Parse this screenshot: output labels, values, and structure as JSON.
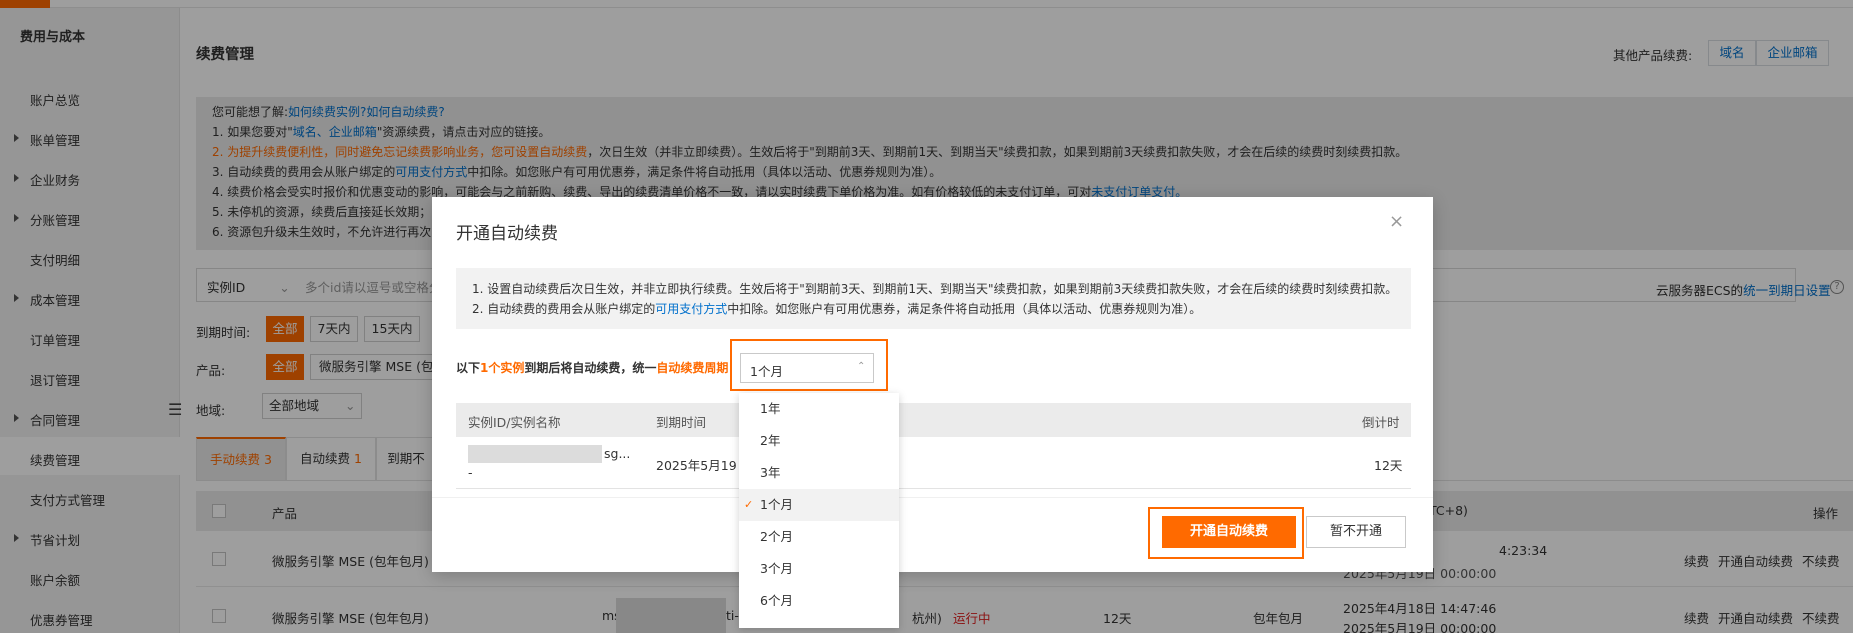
{
  "sidebar": {
    "title": "费用与成本",
    "items": [
      {
        "label": "账户总览",
        "arrow": false
      },
      {
        "label": "账单管理",
        "arrow": true
      },
      {
        "label": "企业财务",
        "arrow": true
      },
      {
        "label": "分账管理",
        "arrow": true
      },
      {
        "label": "支付明细",
        "arrow": false
      },
      {
        "label": "成本管理",
        "arrow": true
      },
      {
        "label": "订单管理",
        "arrow": false
      },
      {
        "label": "退订管理",
        "arrow": false
      },
      {
        "label": "合同管理",
        "arrow": true
      },
      {
        "label": "续费管理",
        "arrow": false,
        "active": true
      },
      {
        "label": "支付方式管理",
        "arrow": false
      },
      {
        "label": "节省计划",
        "arrow": true
      },
      {
        "label": "账户余额",
        "arrow": false
      },
      {
        "label": "优惠券管理",
        "arrow": false
      }
    ],
    "collapse_icon": "☰"
  },
  "header": {
    "title": "续费管理",
    "other_label": "其他产品续费:",
    "other_links": [
      "域名",
      "企业邮箱"
    ]
  },
  "notice": {
    "l0_a": "您可能想了解:",
    "l0_b": "如何续费实例?",
    "l0_c": "如何自动续费?",
    "l1_a": "1. 如果您要对\"",
    "l1_b": "域名、企业邮箱",
    "l1_c": "\"资源续费，请点击对应的链接。",
    "l2_a": "2. 为提升续费便利性，同时避免忘记续费影响业务，您可设置自动续费",
    "l2_b": "，次日生效（并非立即续费）。生效后将于\"到期前3天、到期前1天、到期当天\"续费扣款，如果到期前3天续费扣款失败，才会在后续的续费时刻续费扣款。",
    "l3_a": "3. 自动续费的费用会从账户绑定的",
    "l3_b": "可用支付方式",
    "l3_c": "中扣除。如您账户有可用优惠券，满足条件将自动抵用（具体以活动、优惠券规则为准）。",
    "l4_a": "4. 续费价格会受实时报价和优惠变动的影响，可能会与之前新购、续费、导出的续费清单价格不一致，请以实时续费下单价格为准。如有价格较低的未支付订单，可对",
    "l4_b": "未支付订单支付。",
    "l5": "5. 未停机的资源，续费后直接延长效期；",
    "l6": "6. 资源包升级未生效时，不允许进行再次"
  },
  "filters": {
    "instance_select": "实例ID",
    "search_placeholder": "多个id请以逗号或空格分",
    "ecs_text": "云服务器ECS的",
    "ecs_link": "统一到期日设置",
    "help_icon": "?",
    "expiry_label": "到期时间:",
    "expiry_chips": [
      "全部",
      "7天内",
      "15天内"
    ],
    "product_label": "产品:",
    "product_chips": [
      "全部",
      "微服务引擎 MSE (包年"
    ],
    "region_label": "地域:",
    "region_value": "全部地域",
    "chevron": "⌄"
  },
  "tabs": [
    {
      "label": "手动续费",
      "count": "3"
    },
    {
      "label": "自动续费",
      "count": "1"
    },
    {
      "label": "到期不",
      "count": ""
    }
  ],
  "table": {
    "col_product": "产品",
    "col_time": "TC+8)",
    "col_action": "操作",
    "rows": [
      {
        "product": "微服务引擎 MSE (包年包月)",
        "time1": "4:23:34",
        "time2": "2025年5月19日 00:00:00",
        "actions": [
          "续费",
          "开通自动续费",
          "不续费"
        ]
      },
      {
        "product": "微服务引擎 MSE (包年包月)",
        "id_prefix": "ms",
        "id_frag": "ti-",
        "region": "杭州)",
        "status": "运行中",
        "countdown": "12天",
        "billing": "包年包月",
        "time1": "2025年4月18日 14:47:46",
        "time2": "2025年5月19日 00:00:00",
        "actions": [
          "续费",
          "开通自动续费",
          "不续费"
        ]
      }
    ]
  },
  "modal": {
    "title": "开通自动续费",
    "close_icon": "×",
    "note1": "1. 设置自动续费后次日生效，并非立即执行续费。生效后将于\"到期前3天、到期前1天、到期当天\"续费扣款，如果到期前3天续费扣款失败，才会在后续的续费时刻续费扣款。",
    "note2_a": "2. 自动续费的费用会从账户绑定的",
    "note2_b": "可用支付方式",
    "note2_c": "中扣除。如您账户有可用优惠券，满足条件将自动抵用（具体以活动、优惠券规则为准）。",
    "renew_a": "以下",
    "renew_b": "1个实例",
    "renew_c": "到期后将自动续费，统一",
    "renew_d": "自动续费周期",
    "period_value": "1个月",
    "period_chevron": "⌃",
    "col_id": "实例ID/实例名称",
    "col_expiry": "到期时间",
    "col_countdown": "倒计时",
    "row_id_suffix": "sg...",
    "row_id_line2": "-",
    "row_expiry": "2025年5月19",
    "row_countdown": "12天",
    "confirm": "开通自动续费",
    "cancel": "暂不开通"
  },
  "period_options": [
    {
      "label": "1年"
    },
    {
      "label": "2年"
    },
    {
      "label": "3年"
    },
    {
      "label": "1个月",
      "selected": true
    },
    {
      "label": "2个月"
    },
    {
      "label": "3个月"
    },
    {
      "label": "6个月"
    }
  ],
  "check_icon": "✓",
  "colors": {
    "accent": "#ff6a00",
    "link": "#0070cc",
    "status_running": "#e02020"
  }
}
